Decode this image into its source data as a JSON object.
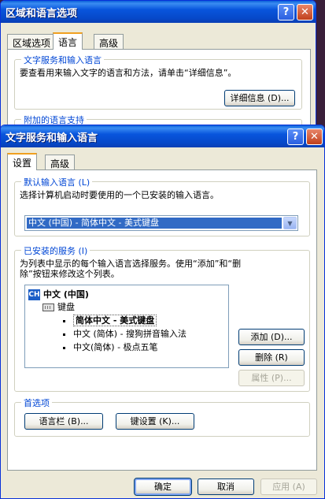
{
  "back_window": {
    "title": "区域和语言选项",
    "tabs": [
      {
        "label": "区域选项"
      },
      {
        "label": "语言"
      },
      {
        "label": "高级"
      }
    ],
    "group_title": "文字服务和输入语言",
    "description": "要查看用来输入文字的语言和方法，请单击“详细信息”。",
    "details_button": "详细信息 (D)...",
    "partial_group_title": "附加的语言支持"
  },
  "front_window": {
    "title": "文字服务和输入语言",
    "help_glyph": "?",
    "close_glyph": "✕",
    "tabs": [
      {
        "label": "设置"
      },
      {
        "label": "高级"
      }
    ],
    "default_language": {
      "group_title": "默认输入语言 (L)",
      "description": "选择计算机启动时要使用的一个已安装的输入语言。",
      "selected": "中文 (中国) - 简体中文 - 美式键盘"
    },
    "installed_services": {
      "group_title": "已安装的服务 (I)",
      "description_line1": "为列表中显示的每个输入语言选择服务。使用“添加”和“删",
      "description_line2": "除”按钮来修改这个列表。",
      "language_code": "CH",
      "language_name": "中文 (中国)",
      "category": "键盘",
      "items": [
        {
          "label": "简体中文 - 美式键盘"
        },
        {
          "label": "中文 (简体) - 搜狗拼音输入法"
        },
        {
          "label": "中文(简体) - 极点五笔"
        }
      ],
      "add_button": "添加 (D)...",
      "remove_button": "删除 (R)",
      "properties_button": "属性 (P)..."
    },
    "preferences": {
      "group_title": "首选项",
      "language_bar_button": "语言栏 (B)...",
      "key_settings_button": "键设置 (K)..."
    },
    "footer": {
      "ok": "确定",
      "cancel": "取消",
      "apply": "应用 (A)"
    }
  }
}
